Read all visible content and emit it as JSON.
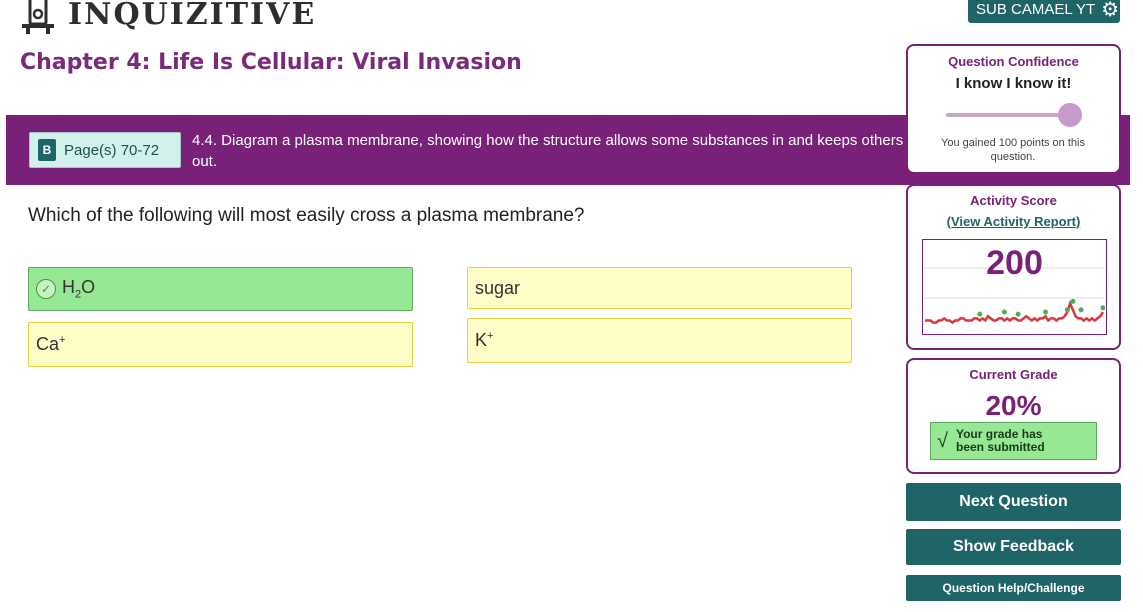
{
  "app": {
    "logo_text": "INQUIZITIVE"
  },
  "user": {
    "name": "SUB CAMAEL YT",
    "icon": "gear-icon"
  },
  "chapter": {
    "title": "Chapter 4: Life Is Cellular: Viral Invasion"
  },
  "objective": {
    "page_button_label": "Page(s) 70-72",
    "page_icon": "book-icon",
    "book_letter": "B",
    "text": "4.4. Diagram a plasma membrane, showing how the structure allows some substances in and keeps others out."
  },
  "question": {
    "text": "Which of the following will most easily cross a plasma membrane?"
  },
  "answers": [
    {
      "base": "H",
      "sub": "2",
      "rest": "O",
      "state": "correct"
    },
    {
      "base": "sugar",
      "state": "neutral"
    },
    {
      "base": "Ca",
      "sup": "+",
      "state": "neutral"
    },
    {
      "base": "K",
      "sup": "+",
      "state": "neutral"
    }
  ],
  "confidence": {
    "title": "Question Confidence",
    "value": "I know I know it!",
    "level": 1.0,
    "points_text": "You gained 100 points on this question."
  },
  "activity": {
    "title": "Activity Score",
    "link_text": "(View Activity Report)",
    "score": "200",
    "history_low_line": [
      4,
      4,
      4,
      3,
      3,
      4,
      4,
      5,
      4,
      4,
      3,
      4,
      4,
      5,
      5,
      4,
      4,
      4,
      5,
      5,
      4,
      5,
      4,
      6,
      5,
      4,
      4,
      5,
      5,
      4,
      5,
      4,
      5,
      5,
      4,
      4,
      5,
      6,
      5,
      4,
      5,
      4,
      5,
      5,
      6,
      4,
      5,
      5,
      4,
      5,
      5,
      6,
      8,
      12,
      9,
      6,
      5,
      5,
      4,
      5,
      4,
      5,
      4,
      5,
      6,
      8
    ],
    "history_high_points": [
      {
        "i": 20,
        "v": 7
      },
      {
        "i": 29,
        "v": 8
      },
      {
        "i": 34,
        "v": 7
      },
      {
        "i": 44,
        "v": 8
      },
      {
        "i": 52,
        "v": 9
      },
      {
        "i": 54,
        "v": 13
      },
      {
        "i": 57,
        "v": 9
      },
      {
        "i": 65,
        "v": 10
      }
    ]
  },
  "grade": {
    "title": "Current Grade",
    "value": "20%",
    "badge_text_line1": "Your grade has",
    "badge_text_line2": "been submitted"
  },
  "buttons": {
    "next": "Next Question",
    "feedback": "Show Feedback",
    "help": "Question Help/Challenge"
  },
  "colors": {
    "brand_purple": "#792179",
    "teal": "#1f6466",
    "correct_green": "#97e894",
    "answer_yellow": "#fffec8"
  }
}
